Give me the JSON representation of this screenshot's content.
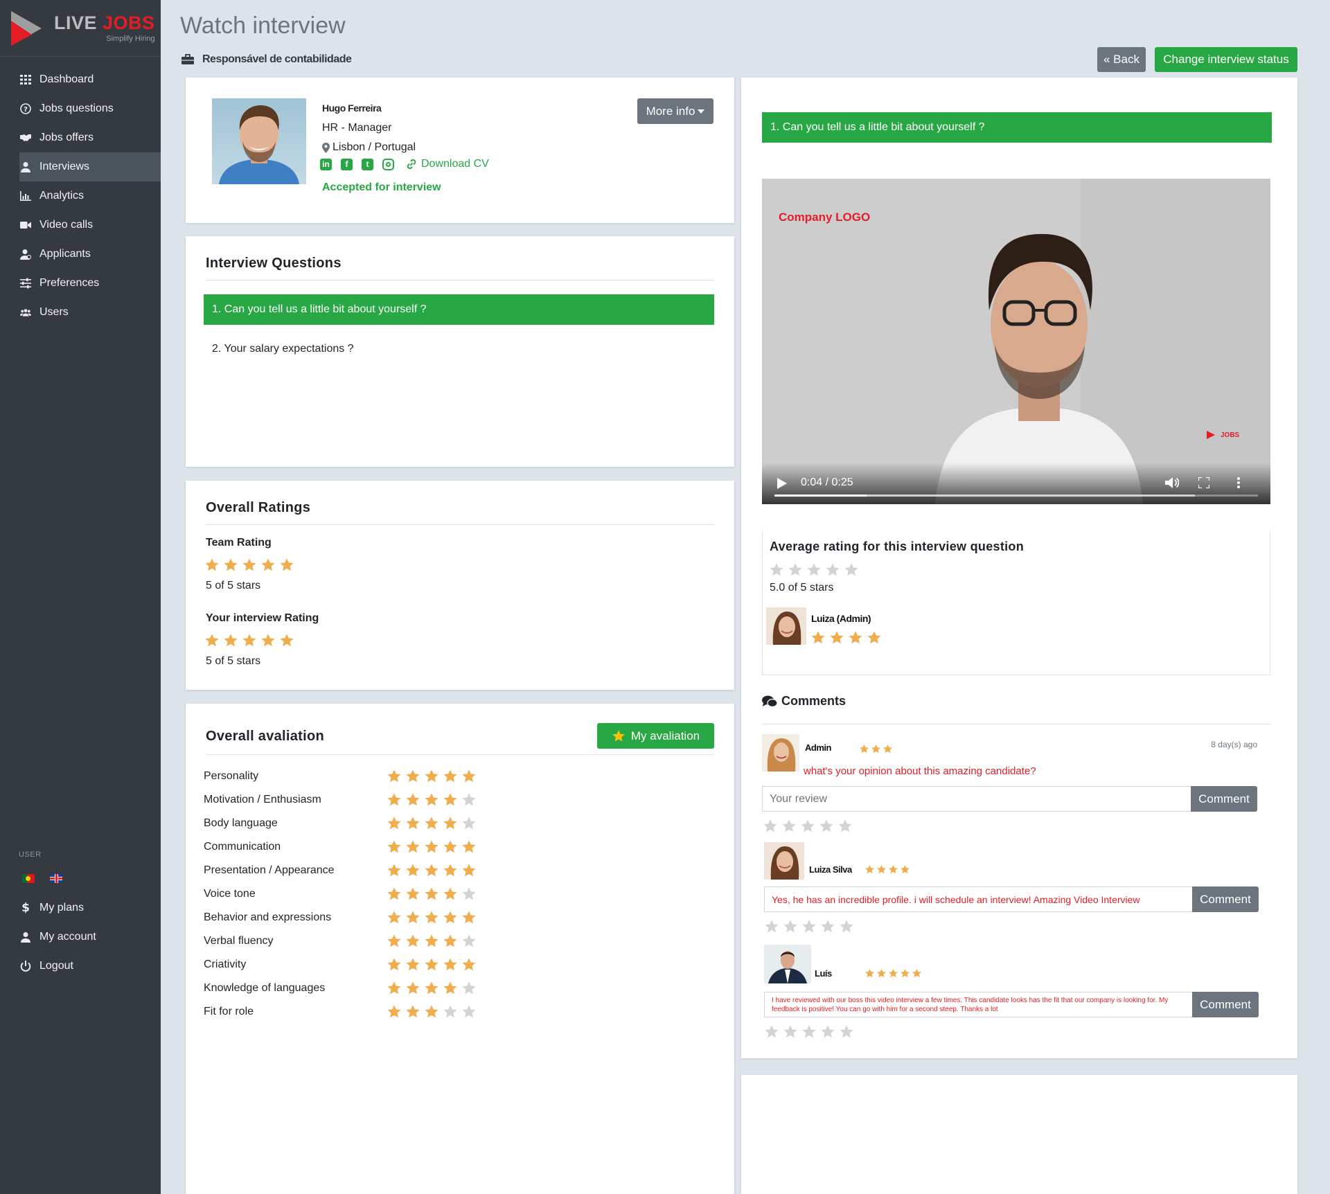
{
  "app": {
    "logo_live": "LIVE",
    "logo_jobs": "JOBS",
    "logo_sub": "Simplify Hiring"
  },
  "sidebar": {
    "items": [
      {
        "label": "Dashboard",
        "icon": "grid-icon"
      },
      {
        "label": "Jobs questions",
        "icon": "question-circle-icon"
      },
      {
        "label": "Jobs offers",
        "icon": "handshake-icon"
      },
      {
        "label": "Interviews",
        "icon": "user-icon"
      },
      {
        "label": "Analytics",
        "icon": "bar-chart-icon"
      },
      {
        "label": "Video calls",
        "icon": "video-icon"
      },
      {
        "label": "Applicants",
        "icon": "user-tie-icon"
      },
      {
        "label": "Preferences",
        "icon": "sliders-icon"
      },
      {
        "label": "Users",
        "icon": "users-icon"
      }
    ],
    "active_index": 3,
    "user_header": "USER",
    "bottom": [
      {
        "label": "My plans",
        "icon": "dollar-icon"
      },
      {
        "label": "My account",
        "icon": "user-icon"
      },
      {
        "label": "Logout",
        "icon": "power-icon"
      }
    ]
  },
  "header": {
    "title": "Watch interview",
    "job_title": "Responsável de contabilidade",
    "back_label": "« Back",
    "status_label": "Change interview status"
  },
  "profile": {
    "name": "Hugo Ferreira",
    "role": "HR - Manager",
    "location": "Lisbon / Portugal",
    "download_cv": "Download CV",
    "status": "Accepted for interview",
    "more_info": "More info"
  },
  "questions": {
    "title": "Interview Questions",
    "items": [
      "1.  Can you tell us a little bit about yourself ?",
      "2.  Your salary expectations ?"
    ]
  },
  "ratings": {
    "title": "Overall Ratings",
    "team_label": "Team Rating",
    "team_stars": 5,
    "team_text": "5 of 5 stars",
    "your_label": "Your interview Rating",
    "your_stars": 5,
    "your_text": "5 of 5 stars"
  },
  "avaliation": {
    "title": "Overall avaliation",
    "button": "My avaliation",
    "rows": [
      {
        "label": "Personality",
        "stars": 5
      },
      {
        "label": "Motivation / Enthusiasm",
        "stars": 4
      },
      {
        "label": "Body language",
        "stars": 4
      },
      {
        "label": "Communication",
        "stars": 5
      },
      {
        "label": "Presentation / Appearance",
        "stars": 5
      },
      {
        "label": "Voice tone",
        "stars": 4
      },
      {
        "label": "Behavior and expressions",
        "stars": 5
      },
      {
        "label": "Verbal fluency",
        "stars": 4
      },
      {
        "label": "Criativity",
        "stars": 5
      },
      {
        "label": "Knowledge of languages",
        "stars": 4
      },
      {
        "label": "Fit for role",
        "stars": 3
      }
    ]
  },
  "video": {
    "question": "1. Can you tell us a little bit about yourself ?",
    "logo_text": "Company LOGO",
    "watermark": "JOBS",
    "time": "0:04 / 0:25",
    "progress": 0.19,
    "buffered": 0.87
  },
  "avg_rating": {
    "title": "Average rating for this interview question",
    "stars": 0,
    "text": "5.0 of 5 stars",
    "rater": "Luiza (Admin)",
    "rater_stars": 4
  },
  "comments": {
    "title": "Comments",
    "items": [
      {
        "author": "Admin",
        "stars": 3,
        "time": "8 day(s) ago",
        "text": "what's your opinion about this amazing candidate?",
        "placeholder": "Your review",
        "button": "Comment"
      },
      {
        "author": "Luiza Silva",
        "stars": 4,
        "text": "Yes, he has an incredible profile. i will schedule an interview! Amazing Video Interview",
        "button": "Comment"
      },
      {
        "author": "Luís",
        "stars": 5,
        "text": "I have reviewed with our boss this video interview a few times.  This candidate looks has the fit that our company is looking for. My feedback is positive! You can go with him for a second steep. Thanks a lot",
        "button": "Comment"
      }
    ]
  },
  "colors": {
    "green": "#28a745",
    "sidebar": "#343a40",
    "star": "#f0ad4e",
    "star_empty": "#d3d3d3",
    "red": "#e41d24"
  }
}
